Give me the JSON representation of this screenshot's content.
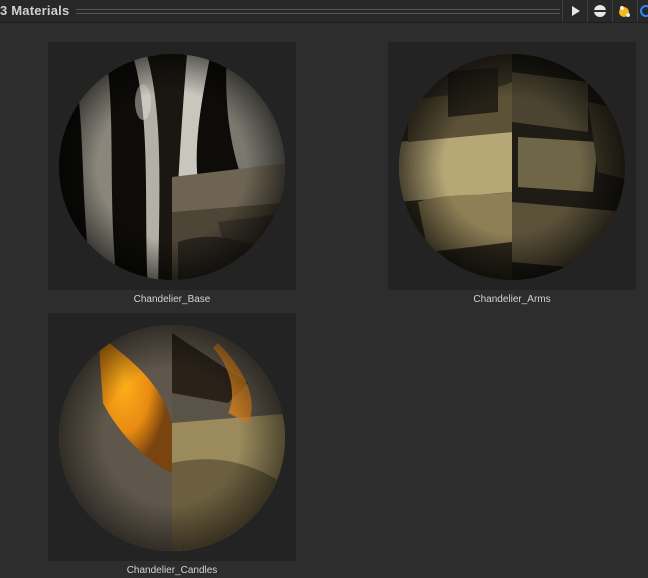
{
  "header": {
    "title": "3 Materials",
    "buttons": [
      {
        "name": "play",
        "icon": "play-icon"
      },
      {
        "name": "sphere-preview",
        "icon": "sphere-icon"
      },
      {
        "name": "lights",
        "icon": "lights-icon"
      }
    ]
  },
  "materials": [
    {
      "name": "Chandelier_Base"
    },
    {
      "name": "Chandelier_Arms"
    },
    {
      "name": "Chandelier_Candles"
    }
  ],
  "colors": {
    "panel_bg": "#2d2d2d",
    "tile_bg": "#232323",
    "accent_yellow": "#f3b81b"
  }
}
